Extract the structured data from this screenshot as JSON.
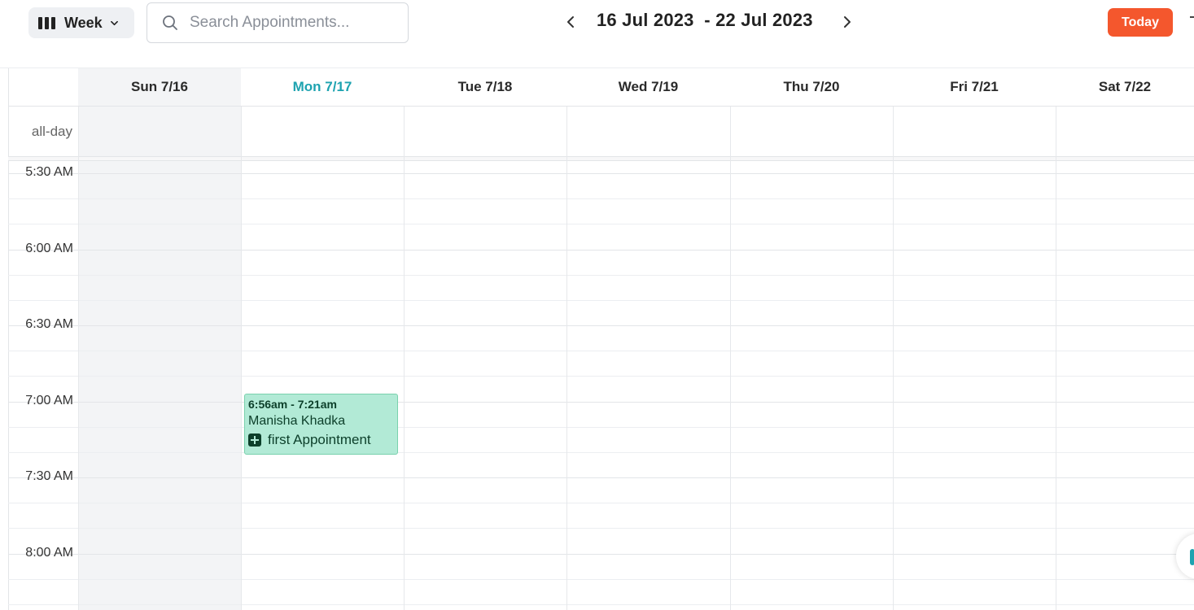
{
  "toolbar": {
    "view_label": "Week",
    "search_placeholder": "Search Appointments...",
    "date_range": "16 Jul 2023  - 22 Jul 2023",
    "today_label": "Today"
  },
  "calendar": {
    "allday_label": "all-day",
    "days": [
      {
        "label": "Sun 7/16"
      },
      {
        "label": "Mon 7/17"
      },
      {
        "label": "Tue 7/18"
      },
      {
        "label": "Wed 7/19"
      },
      {
        "label": "Thu 7/20"
      },
      {
        "label": "Fri 7/21"
      },
      {
        "label": "Sat 7/22"
      }
    ],
    "times": [
      "5:30 AM",
      "6:00 AM",
      "6:30 AM",
      "7:00 AM",
      "7:30 AM",
      "8:00 AM"
    ],
    "today_index": 1
  },
  "event": {
    "time": "6:56am - 7:21am",
    "client": "Manisha Khadka",
    "title": "first Appointment",
    "color": "#b2ead6"
  },
  "colors": {
    "accent": "#f4572d",
    "today_text": "#1ea3b0"
  }
}
